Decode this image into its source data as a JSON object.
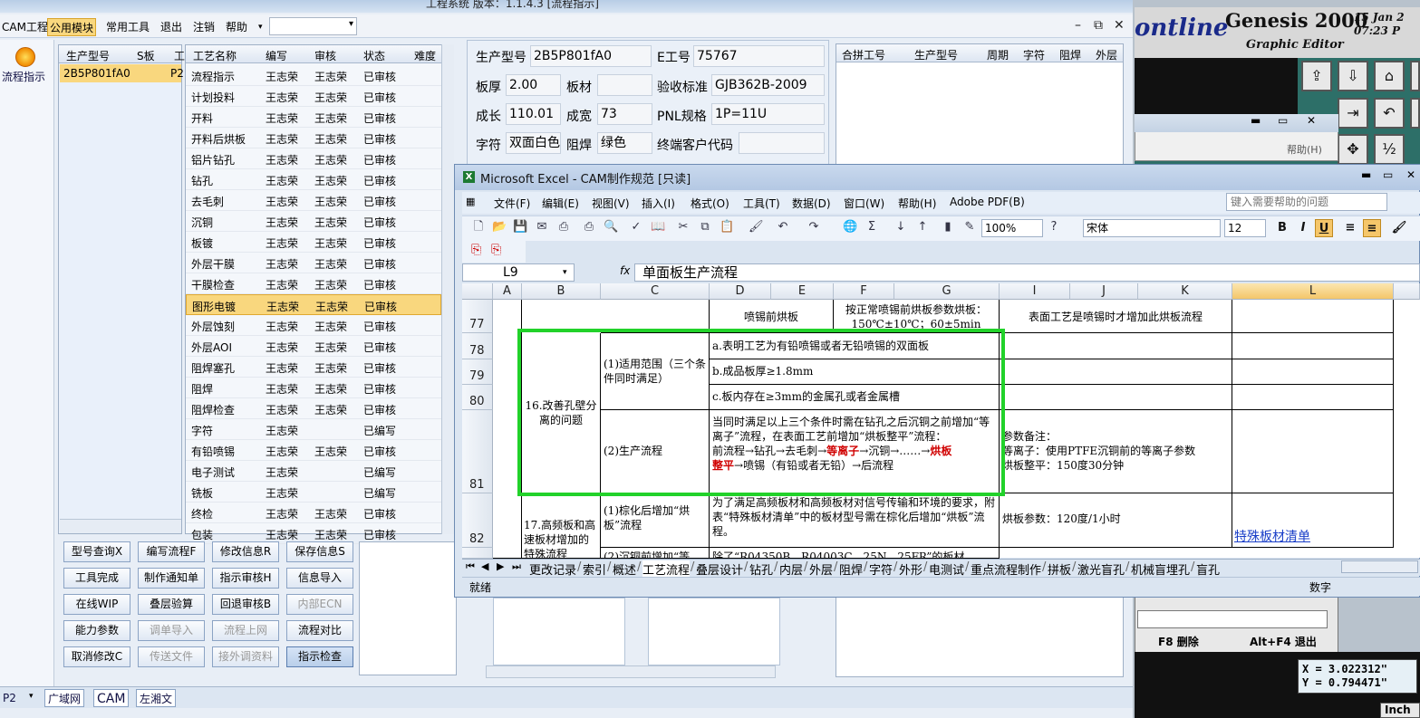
{
  "cam": {
    "title": "工程系统  版本：1.1.4.3  [流程指示]",
    "menu": [
      "CAM工程",
      "公用模块",
      "常用工具",
      "退出",
      "注销",
      "帮助"
    ],
    "active_menu": "公用模块",
    "nav_label": "流程指示",
    "product_headers": [
      "生产型号",
      "S板",
      "工"
    ],
    "product_rows": [
      {
        "model": "2B5P801fA0",
        "s": "P2"
      }
    ],
    "process_headers": [
      "工艺名称",
      "编写",
      "审核",
      "状态",
      "难度"
    ],
    "process_rows": [
      [
        "流程指示",
        "王志荣",
        "王志荣",
        "已审核"
      ],
      [
        "计划投料",
        "王志荣",
        "王志荣",
        "已审核"
      ],
      [
        "开料",
        "王志荣",
        "王志荣",
        "已审核"
      ],
      [
        "开料后烘板",
        "王志荣",
        "王志荣",
        "已审核"
      ],
      [
        "铝片钻孔",
        "王志荣",
        "王志荣",
        "已审核"
      ],
      [
        "钻孔",
        "王志荣",
        "王志荣",
        "已审核"
      ],
      [
        "去毛刺",
        "王志荣",
        "王志荣",
        "已审核"
      ],
      [
        "沉铜",
        "王志荣",
        "王志荣",
        "已审核"
      ],
      [
        "板镀",
        "王志荣",
        "王志荣",
        "已审核"
      ],
      [
        "外层干膜",
        "王志荣",
        "王志荣",
        "已审核"
      ],
      [
        "干膜检查",
        "王志荣",
        "王志荣",
        "已审核"
      ],
      [
        "图形电镀",
        "王志荣",
        "王志荣",
        "已审核"
      ],
      [
        "外层蚀刻",
        "王志荣",
        "王志荣",
        "已审核"
      ],
      [
        "外层AOI",
        "王志荣",
        "王志荣",
        "已审核"
      ],
      [
        "阻焊塞孔",
        "王志荣",
        "王志荣",
        "已审核"
      ],
      [
        "阻焊",
        "王志荣",
        "王志荣",
        "已审核"
      ],
      [
        "阻焊检查",
        "王志荣",
        "王志荣",
        "已审核"
      ],
      [
        "字符",
        "王志荣",
        "",
        "已编写"
      ],
      [
        "有铅喷锡",
        "王志荣",
        "王志荣",
        "已审核"
      ],
      [
        "电子测试",
        "王志荣",
        "",
        "已编写"
      ],
      [
        "铣板",
        "王志荣",
        "",
        "已编写"
      ],
      [
        "终检",
        "王志荣",
        "王志荣",
        "已审核"
      ],
      [
        "包装",
        "王志荣",
        "王志荣",
        "已审核"
      ]
    ],
    "buttons": [
      [
        "型号查询X",
        "编写流程F",
        "修改信息R",
        "保存信息S"
      ],
      [
        "工具完成",
        "制作通知单",
        "指示审核H",
        "信息导入"
      ],
      [
        "在线WIP",
        "叠层验算",
        "回退审核B",
        "内部ECN"
      ],
      [
        "能力参数",
        "调单导入",
        "流程上网",
        "流程对比"
      ],
      [
        "取消修改C",
        "传送文件",
        "接外调资料",
        "指示检查"
      ]
    ],
    "info": {
      "model_label": "生产型号",
      "model": "2B5P801fA0",
      "e_label": "E工号",
      "e_no": "75767",
      "thick_label": "板厚",
      "thick": "2.00",
      "material_label": "板材",
      "material": "",
      "accept_label": "验收标准",
      "accept": "GJB362B-2009",
      "len_label": "成长",
      "length": "110.01",
      "wid_label": "成宽",
      "width": "73",
      "pnl_label": "PNL规格",
      "pnl": "1P=11U",
      "char_label": "字符",
      "char": "双面白色",
      "mask_label": "阻焊",
      "mask": "绿色",
      "cust_label": "终端客户代码",
      "cust": ""
    },
    "right_headers": [
      "合拼工号",
      "生产型号",
      "周期",
      "字符",
      "阻焊",
      "外层"
    ],
    "status_tabs": [
      "P2",
      "广域网",
      "CAM",
      "左湘文"
    ]
  },
  "genesis": {
    "logo_left": "ontline",
    "logo": "Genesis 2000",
    "subtitle": "Graphic Editor",
    "date": "15 Jan 2",
    "time": "07:23 P",
    "help": "帮助(H)",
    "f8": "F8 删除",
    "altf4": "Alt+F4 退出",
    "coord_x": "X = 3.022312\"",
    "coord_y": "Y = 0.794471\"",
    "unit": "Inch"
  },
  "excel": {
    "title": "Microsoft Excel - CAM制作规范  [只读]",
    "menu": [
      "文件(F)",
      "编辑(E)",
      "视图(V)",
      "插入(I)",
      "格式(O)",
      "工具(T)",
      "数据(D)",
      "窗口(W)",
      "帮助(H)",
      "Adobe PDF(B)"
    ],
    "help_placeholder": "键入需要帮助的问题",
    "zoom": "100%",
    "font": "宋体",
    "font_size": "12",
    "namebox": "L9",
    "formula": "单面板生产流程",
    "columns": [
      "A",
      "B",
      "C",
      "D",
      "E",
      "F",
      "G",
      "I",
      "J",
      "K",
      "L"
    ],
    "rows": {
      "r77": {
        "num": "77",
        "d": "喷锡前烘板",
        "f": "按正常喷锡前烘板参数烘板：150℃±10℃；60±5min",
        "i": "表面工艺是喷锡时才增加此烘板流程"
      },
      "r78": {
        "num": "78",
        "d": "a.表明工艺为有铅喷锡或者无铅喷锡的双面板"
      },
      "r79": {
        "num": "79",
        "d": "b.成品板厚≥1.8mm"
      },
      "r80": {
        "num": "80",
        "d": "c.板内存在≥3mm的金属孔或者金属槽"
      },
      "r81": {
        "num": "81",
        "c": "(2)生产流程",
        "d1": "当同时满足以上三个条件时需在钻孔之后沉铜之前增加“等离子”流程，在表面工艺前增加“烘板整平”流程：",
        "d2": "前流程→钻孔→去毛刺→",
        "d2r1": "等离子",
        "d2b": "→沉铜→……→",
        "d2r2": "烘板",
        "d3r": "整平",
        "d3": "→喷锡（有铅或者无铅）→后流程",
        "i1": "参数备注：",
        "i2": "等离子：使用PTFE沉铜前的等离子参数",
        "i3": "烘板整平：150度30分钟"
      },
      "group16": "16.改善孔壁分离的问题",
      "c78": "(1)适用范围（三个条件同时满足）",
      "r82": {
        "num": "82",
        "b": "17.高频板和高速板材增加的特殊流程",
        "c": "(1)棕化后增加“烘板”流程",
        "d": "为了满足高频板材和高频板材对信号传输和环境的要求，附表“特殊板材清单”中的板材型号需在棕化后增加“烘板”流程。",
        "i": "烘板参数：120度/1小时",
        "l": "特殊板材清单"
      },
      "r83": {
        "c": "(2)沉铜前增加“等",
        "d": "除了“R04350B、R04003C、25N、25FR”的板材"
      }
    },
    "sheets": [
      "更改记录",
      "索引",
      "概述",
      "工艺流程",
      "叠层设计",
      "钻孔",
      "内层",
      "外层",
      "阻焊",
      "字符",
      "外形",
      "电测试",
      "重点流程制作",
      "拼板",
      "激光盲孔",
      "机械盲埋孔",
      "盲孔"
    ],
    "active_sheet": "工艺流程",
    "status": "就绪",
    "num": "数字"
  },
  "colors": {
    "accent_selection": "#f9d77e",
    "highlight_box": "#22d22a",
    "alert_red": "#d00000"
  }
}
